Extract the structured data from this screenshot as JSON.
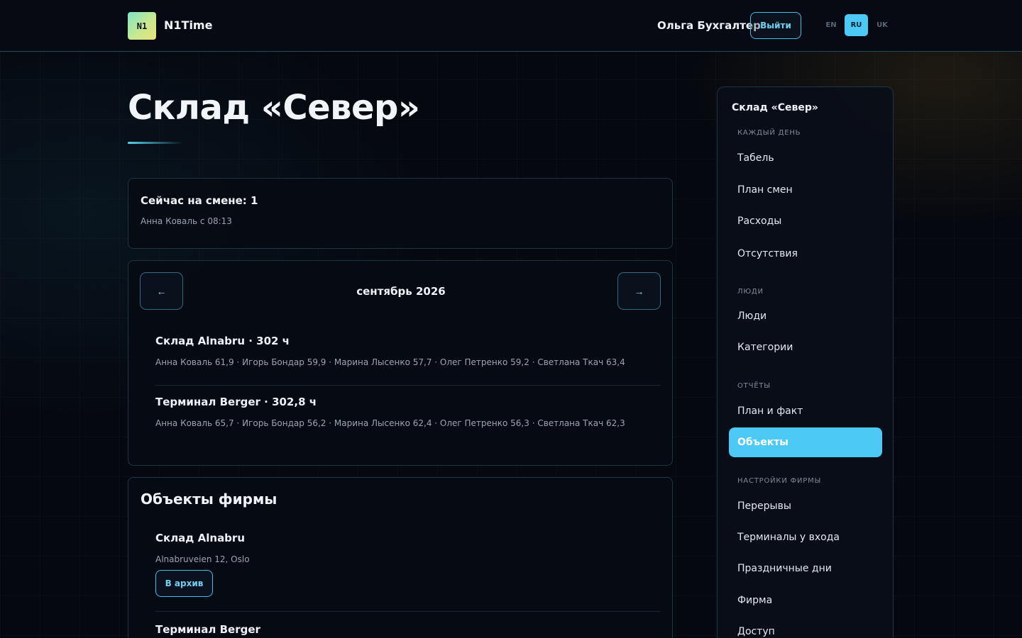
{
  "header": {
    "logo_text": "N1",
    "brand": "N1Time",
    "user_name": "Ольга Бухгалтер",
    "logout_label": "Выйти",
    "languages": [
      "EN",
      "RU",
      "UK"
    ],
    "active_language": "RU",
    "accent_color": "#4cc9f5"
  },
  "page": {
    "title": "Склад «Север»"
  },
  "shift": {
    "title": "Сейчас на смене: 1",
    "subtitle": "Анна Коваль с 08:13"
  },
  "month": {
    "prev_label": "←",
    "next_label": "→",
    "label": "сентябрь 2026",
    "sites": [
      {
        "title": "Склад Alnabru · 302 ч",
        "people": "Анна Коваль 61,9 · Игорь Бондар 59,9 · Марина Лысенко 57,7 · Олег Петренко 59,2 · Светлана Ткач 63,4"
      },
      {
        "title": "Терминал Berger · 302,8 ч",
        "people": "Анна Коваль 65,7 · Игорь Бондар 56,2 · Марина Лысенко 62,4 · Олег Петренко 56,3 · Светлана Ткач 62,3"
      }
    ]
  },
  "objects": {
    "title": "Объекты фирмы",
    "items": [
      {
        "name": "Склад Alnabru",
        "address": "Alnabruveien 12, Oslo",
        "archive_label": "В архив"
      },
      {
        "name": "Терминал Berger"
      }
    ]
  },
  "sidebar": {
    "title": "Склад «Север»",
    "sections": [
      {
        "label": "каждый день",
        "items": [
          "Табель",
          "План смен",
          "Расходы",
          "Отсутствия"
        ]
      },
      {
        "label": "люди",
        "items": [
          "Люди",
          "Категории"
        ]
      },
      {
        "label": "отчёты",
        "items": [
          "План и факт",
          "Объекты"
        ]
      },
      {
        "label": "настройки фирмы",
        "items": [
          "Перерывы",
          "Терминалы у входа",
          "Праздничные дни",
          "Фирма",
          "Доступ"
        ]
      }
    ],
    "active_item": "Объекты"
  }
}
